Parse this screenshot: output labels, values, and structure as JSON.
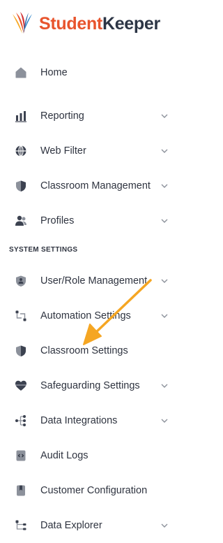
{
  "app": {
    "name_part1": "Student",
    "name_part2": "Keeper",
    "brand_color": "#e8542d",
    "text_color": "#2c3545"
  },
  "nav": {
    "items": [
      {
        "label": "Home",
        "icon": "home-icon",
        "has_chevron": false
      },
      {
        "label": "Reporting",
        "icon": "bar-chart-icon",
        "has_chevron": true
      },
      {
        "label": "Web Filter",
        "icon": "globe-icon",
        "has_chevron": true
      },
      {
        "label": "Classroom Management",
        "icon": "shield-icon",
        "has_chevron": true
      },
      {
        "label": "Profiles",
        "icon": "users-icon",
        "has_chevron": true
      }
    ]
  },
  "system_settings": {
    "heading": "SYSTEM SETTINGS",
    "items": [
      {
        "label": "User/Role Management",
        "icon": "user-badge-icon",
        "has_chevron": true
      },
      {
        "label": "Automation Settings",
        "icon": "workflow-icon",
        "has_chevron": true
      },
      {
        "label": "Classroom Settings",
        "icon": "shield-icon",
        "has_chevron": false
      },
      {
        "label": "Safeguarding Settings",
        "icon": "heart-icon",
        "has_chevron": true
      },
      {
        "label": "Data Integrations",
        "icon": "hierarchy-icon",
        "has_chevron": true
      },
      {
        "label": "Audit Logs",
        "icon": "code-file-icon",
        "has_chevron": false
      },
      {
        "label": "Customer Configuration",
        "icon": "bookmark-icon",
        "has_chevron": false
      },
      {
        "label": "Data Explorer",
        "icon": "tree-icon",
        "has_chevron": true
      }
    ]
  },
  "annotation": {
    "arrow_color": "#f5a623",
    "points_to": "Classroom Settings"
  }
}
